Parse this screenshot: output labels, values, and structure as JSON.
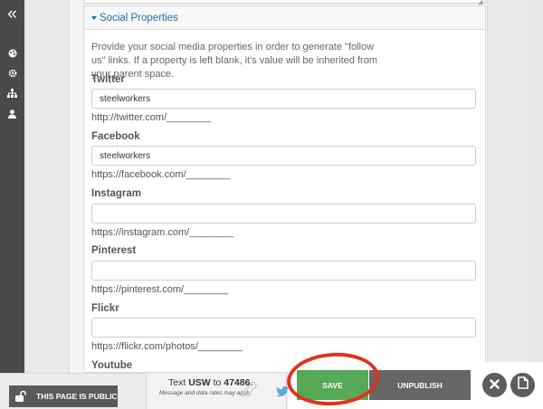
{
  "sidebar": {
    "icons": [
      "collapse-icon",
      "palette-icon",
      "gear-icon",
      "sitemap-icon",
      "user-icon"
    ]
  },
  "section": {
    "title": "Social Properties",
    "description": "Provide your social media properties in order to generate \"follow us\" links. If a property is left blank, it's value will be inherited from your parent space."
  },
  "fields": {
    "twitter": {
      "label": "Twitter",
      "value": "steelworkers",
      "hint": "http://twitter.com/________"
    },
    "facebook": {
      "label": "Facebook",
      "value": "steelworkers",
      "hint": "https://facebook.com/________"
    },
    "instagram": {
      "label": "Instagram",
      "value": "",
      "hint": "https://instagram.com/________"
    },
    "pinterest": {
      "label": "Pinterest",
      "value": "",
      "hint": "https://pinterest.com/________"
    },
    "flickr": {
      "label": "Flickr",
      "value": "",
      "hint": "https://flickr.com/photos/________"
    },
    "youtube": {
      "label": "Youtube"
    }
  },
  "bottom_bar": {
    "public_label": "THIS PAGE IS PUBLIC",
    "sms_prefix": "Text ",
    "sms_code": "USW",
    "sms_middle": " to ",
    "sms_number": "47486.",
    "sms_fine": "Message and data rates may apply.",
    "save_label": "SAVE",
    "unpublish_label": "UNPUBLISH"
  },
  "colors": {
    "save_green": "#57a957",
    "link_blue": "#1d6fa5",
    "annotation_red": "#e0321c",
    "sidebar_dark": "#4a4a4a"
  }
}
